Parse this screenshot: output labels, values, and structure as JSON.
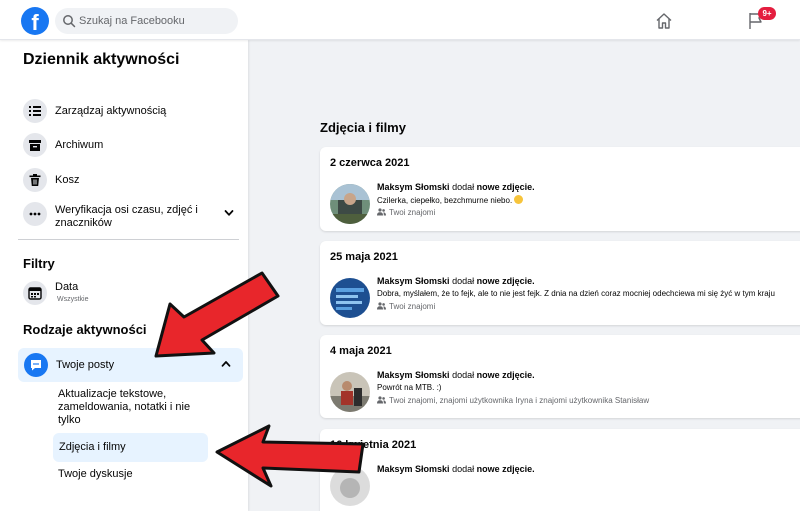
{
  "header": {
    "logo_letter": "f",
    "search_placeholder": "Szukaj na Facebooku",
    "notification_badge": "9+"
  },
  "sidebar": {
    "title": "Dziennik aktywności",
    "items": [
      {
        "label": "Zarządzaj aktywnością",
        "icon": "list-icon"
      },
      {
        "label": "Archiwum",
        "icon": "archive-icon"
      },
      {
        "label": "Kosz",
        "icon": "trash-icon"
      },
      {
        "label": "Weryfikacja osi czasu, zdjęć i znaczników",
        "icon": "more-icon"
      }
    ],
    "filters_heading": "Filtry",
    "date_filter": {
      "label": "Data",
      "value": "Wszystkie"
    },
    "types_heading": "Rodzaje aktywności",
    "posts_label": "Twoje posty",
    "sub_items": [
      "Aktualizacje tekstowe, zameldowania, notatki i nie tylko",
      "Zdjęcia i filmy"
    ],
    "cut_item": "Twoje dyskusje"
  },
  "main": {
    "title": "Zdjęcia i filmy",
    "entries": [
      {
        "date": "2 czerwca 2021",
        "author": "Maksym Słomski",
        "action": "dodał",
        "object": "nowe zdjęcie.",
        "description": "Czilerka, ciepełko, bezchmurne niebo.",
        "audience": "Twoi znajomi"
      },
      {
        "date": "25 maja 2021",
        "author": "Maksym Słomski",
        "action": "dodał",
        "object": "nowe zdjęcie.",
        "description": "Dobra, myślałem, że to fejk, ale to nie jest fejk. Z dnia na dzień coraz mocniej odechciewa mi się żyć w tym kraju",
        "audience": "Twoi znajomi"
      },
      {
        "date": "4 maja 2021",
        "author": "Maksym Słomski",
        "action": "dodał",
        "object": "nowe zdjęcie.",
        "description": "Powrót na MTB. :)",
        "audience": "Twoi znajomi, znajomi użytkownika Iryna i znajomi użytkownika Stanisław"
      },
      {
        "date": "16 kwietnia 2021",
        "author": "Maksym Słomski",
        "action": "dodał",
        "object": "nowe zdjęcie.",
        "description": "",
        "audience": ""
      }
    ]
  },
  "colors": {
    "brand": "#1877f2",
    "highlight": "#e7f3ff",
    "badge": "#e41e3f",
    "arrow": "#e8262b"
  }
}
